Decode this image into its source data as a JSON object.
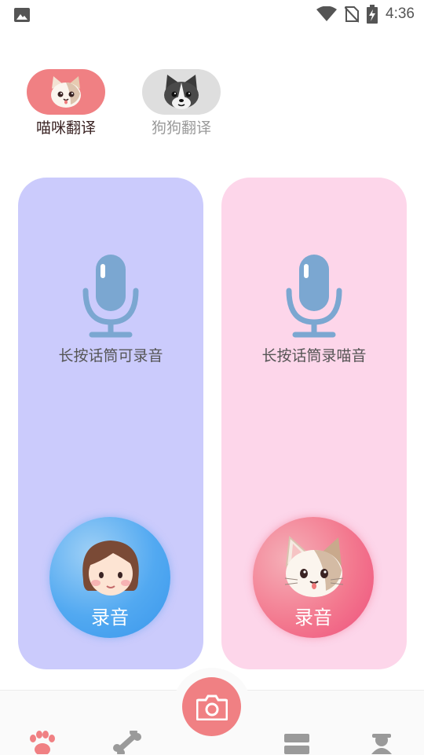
{
  "status_bar": {
    "time": "4:36"
  },
  "tabs": [
    {
      "label": "喵咪翻译",
      "active": true,
      "icon": "cat-face-icon"
    },
    {
      "label": "狗狗翻译",
      "active": false,
      "icon": "dog-face-icon"
    }
  ],
  "panels": {
    "human": {
      "hint": "长按话筒可录音",
      "button_label": "录音",
      "icon": "girl-avatar-icon"
    },
    "cat": {
      "hint": "长按话筒录喵音",
      "button_label": "录音",
      "icon": "cat-avatar-icon"
    }
  },
  "bottom_nav": {
    "items": [
      "paw-icon",
      "bone-icon",
      "camera-icon",
      "list-icon",
      "profile-icon"
    ],
    "accent": "#f08083"
  },
  "colors": {
    "tab_active_bg": "#f08083",
    "tab_inactive_bg": "#dedede",
    "panel_left_bg": "#cbcbfc",
    "panel_right_bg": "#fdd6ea",
    "mic": "#7ba7d1"
  }
}
